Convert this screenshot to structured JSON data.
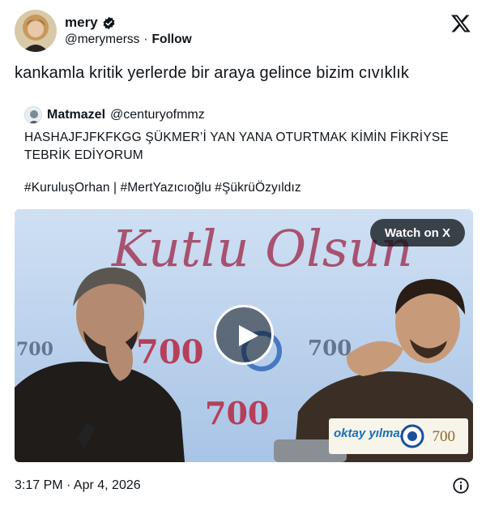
{
  "author": {
    "display_name": "mery",
    "handle": "@merymerss",
    "separator": "·",
    "follow_label": "Follow"
  },
  "tweet_text": "kankamla kritik yerlerde bir araya gelince bizim cıvıklık",
  "quote": {
    "display_name": "Matmazel",
    "handle": "@centuryofmmz",
    "text": "HASHAJFJFKFKGG ŞÜKMER’İ YAN YANA OTURTMAK KİMİN FİKRİYSE TEBRİK EDİYORUM",
    "hashtags": "#KuruluşOrhan | #MertYazıcıoğlu #ŞükrüÖzyıldız",
    "video": {
      "watch_label": "Watch on X",
      "backdrop_script": "Kutlu Olsun",
      "banner_number": "700",
      "logo_brand": "oktay yılmaz",
      "logo_number": "700"
    }
  },
  "timestamp": "3:17 PM · Apr 4, 2026",
  "icons": [
    "verified-badge-icon",
    "x-logo-icon",
    "play-icon",
    "info-icon"
  ],
  "colors": {
    "text": "#0f1419",
    "verified": "#0f1419",
    "backdrop": "#bcd3ee"
  }
}
